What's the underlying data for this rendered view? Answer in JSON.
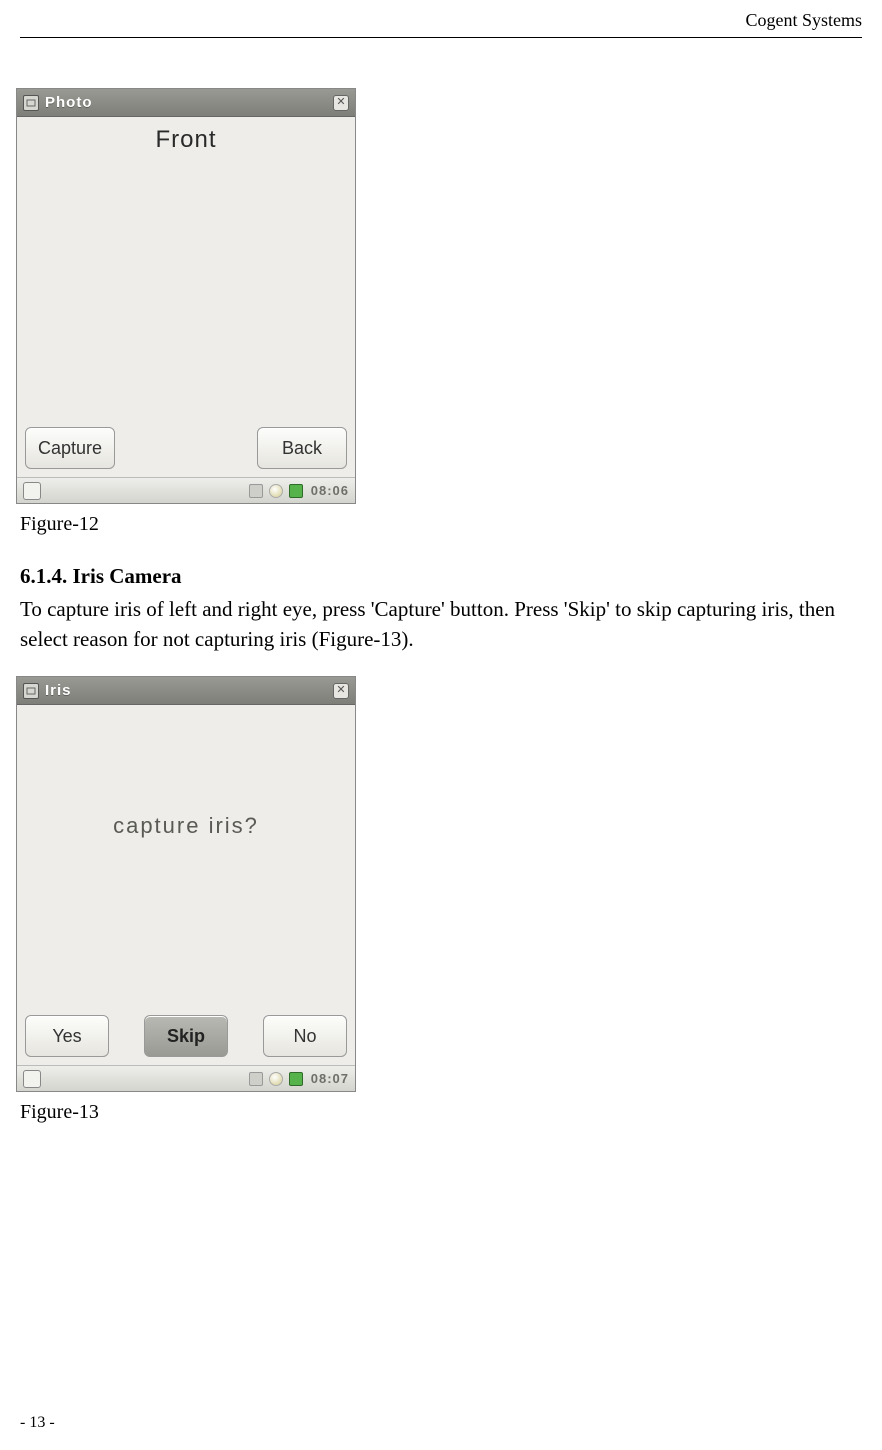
{
  "header": {
    "company": "Cogent Systems"
  },
  "figure12": {
    "caption": "Figure-12",
    "titlebar": {
      "title": "Photo"
    },
    "content_label": "Front",
    "buttons": {
      "capture": "Capture",
      "back": "Back"
    },
    "taskbar": {
      "time": "08:06"
    }
  },
  "section": {
    "heading": "6.1.4. Iris Camera",
    "body": "To capture iris of left and right eye, press 'Capture' button. Press 'Skip' to skip capturing iris, then select reason for not capturing iris (Figure-13)."
  },
  "figure13": {
    "caption": "Figure-13",
    "titlebar": {
      "title": "Iris"
    },
    "content_label": "capture  iris?",
    "buttons": {
      "yes": "Yes",
      "skip": "Skip",
      "no": "No"
    },
    "taskbar": {
      "time": "08:07"
    }
  },
  "footer": {
    "page": "- 13 -"
  }
}
